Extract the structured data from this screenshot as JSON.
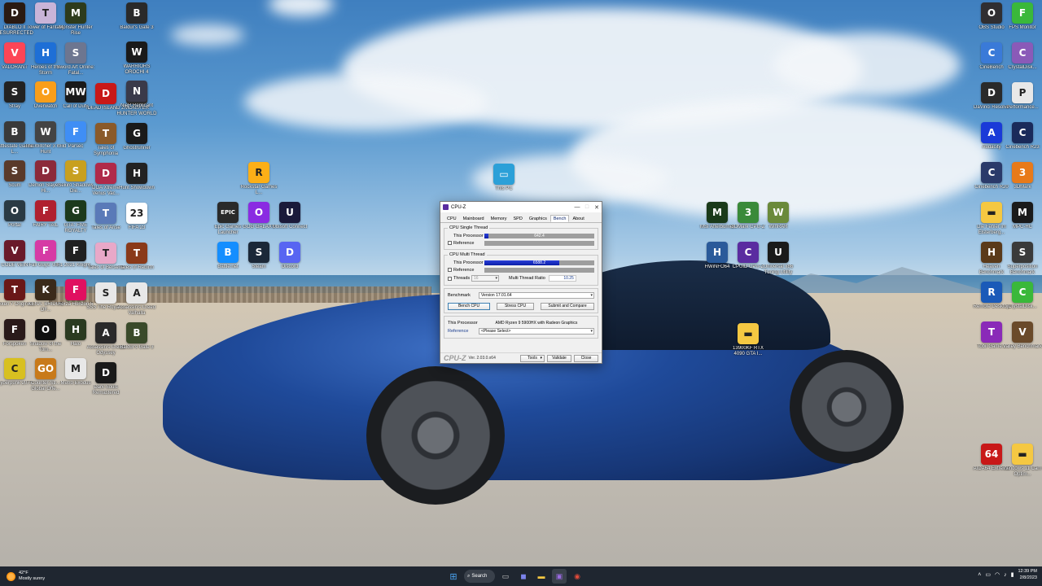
{
  "desktop": {
    "left_icons": [
      {
        "label": "DIABLO II RESURRECTED",
        "icon": "diablo-icon",
        "color": "#2a1a12",
        "glyph": "D"
      },
      {
        "label": "Tower of Fantasy",
        "icon": "tower-of-fantasy-icon",
        "color": "#c9b4d8",
        "glyph": "T"
      },
      {
        "label": "Monster Hunter Rise",
        "icon": "monster-hunter-icon",
        "color": "#2d3b1c",
        "glyph": "M"
      },
      {
        "label": "VALORANT",
        "icon": "valorant-icon",
        "color": "#fd4556",
        "glyph": "V"
      },
      {
        "label": "Heroes of the Storm",
        "icon": "heroes-storm-icon",
        "color": "#1e6fd6",
        "glyph": "H"
      },
      {
        "label": "Sword Art Online: Fatal...",
        "icon": "sword-art-icon",
        "color": "#6d7690",
        "glyph": "S"
      },
      {
        "label": "Stray",
        "icon": "stray-icon",
        "color": "#222222",
        "glyph": "S"
      },
      {
        "label": "Overwatch",
        "icon": "overwatch-icon",
        "color": "#f99e1a",
        "glyph": "O"
      },
      {
        "label": "Call of Duty",
        "icon": "call-of-duty-icon",
        "color": "#1a1a1a",
        "glyph": "MW"
      },
      {
        "label": "Battlestate Games L...",
        "icon": "battlestate-icon",
        "color": "#3a3a3a",
        "glyph": "B"
      },
      {
        "label": "The Witcher 3 Wild Hunt",
        "icon": "witcher-icon",
        "color": "#444444",
        "glyph": "W"
      },
      {
        "label": "Parsec",
        "icon": "parsec-icon",
        "color": "#3f8ef5",
        "glyph": "F"
      },
      {
        "label": "Scum",
        "icon": "scum-icon",
        "color": "#5a3a2a",
        "glyph": "S"
      },
      {
        "label": "Demon Slayer -Hi...",
        "icon": "demon-slayer-icon",
        "color": "#8c2a3a",
        "glyph": "D"
      },
      {
        "label": "Sekiro Shadows Die...",
        "icon": "sekiro-icon",
        "color": "#c8a020",
        "glyph": "S"
      },
      {
        "label": "Portal",
        "icon": "portal-icon",
        "color": "#2a3a44",
        "glyph": "O"
      },
      {
        "label": "FAIRY TAIL",
        "icon": "fairy-tail-icon",
        "color": "#b02030",
        "glyph": "F"
      },
      {
        "label": "GTA: FIVE ROYALTY",
        "icon": "gta-five-icon",
        "color": "#1c3a1c",
        "glyph": "G"
      },
      {
        "label": "CODE VEIN",
        "icon": "code-vein-icon",
        "color": "#6a1a2a",
        "glyph": "V"
      },
      {
        "label": "Fall Guys: Ult...",
        "icon": "fall-guys-icon",
        "color": "#d63aa5",
        "glyph": "F"
      },
      {
        "label": "F1 2021 Knight...",
        "icon": "f1-icon",
        "color": "#202020",
        "glyph": "F"
      },
      {
        "label": "Tekken 7 Original...",
        "icon": "tekken-icon",
        "color": "#6a1818",
        "glyph": "T"
      },
      {
        "label": "KENA: BRIDGE OF...",
        "icon": "kena-icon",
        "color": "#3a2a1a",
        "glyph": "K"
      },
      {
        "label": "Forza Horizon 5",
        "icon": "forza-icon",
        "color": "#e01060",
        "glyph": "F"
      },
      {
        "label": "Forspoken",
        "icon": "forspoken-icon",
        "color": "#2a1a1a",
        "glyph": "F"
      },
      {
        "label": "Shadow of the Tom...",
        "icon": "shadow-tomb-icon",
        "color": "#101010",
        "glyph": "O"
      },
      {
        "label": "Halo",
        "icon": "halo-icon",
        "color": "#2a3a20",
        "glyph": "H"
      },
      {
        "label": "Cyberpunk 2077",
        "icon": "cyberpunk-icon",
        "color": "#d8c020",
        "glyph": "C"
      },
      {
        "label": "Counter-Str... Global Offe...",
        "icon": "counter-strike-icon",
        "color": "#c87a1a",
        "glyph": "GO"
      },
      {
        "label": "Metro Exodus",
        "icon": "metro-icon",
        "color": "#e8e8e8",
        "glyph": "M"
      }
    ],
    "col3_icons": [
      {
        "label": "DEAD ISLAND 2",
        "icon": "dead-island-icon",
        "color": "#c81818",
        "glyph": "D"
      },
      {
        "label": "MONSTER HUNTER WORLD",
        "icon": "mhw-icon",
        "color": "#3a3a3a",
        "glyph": "M"
      },
      {
        "label": "Tales of Symphonia",
        "icon": "tales-symphonia-icon",
        "color": "#8a5a2a",
        "glyph": "T"
      },
      {
        "label": "Ghostrunner",
        "icon": "ghostrunner-icon",
        "color": "#1a1a1a",
        "glyph": "G"
      },
      {
        "label": "DOA Xtreme Venus Vac...",
        "icon": "doa-icon",
        "color": "#b02a4a",
        "glyph": "D"
      },
      {
        "label": "Hunt Showdown",
        "icon": "hunt-icon",
        "color": "#222222",
        "glyph": "H"
      },
      {
        "label": "Tales of Arise",
        "icon": "tales-arise-icon",
        "color": "#5a7ab8",
        "glyph": "T"
      },
      {
        "label": "FIFA 23",
        "icon": "fifa-icon",
        "color": "#ffffff",
        "glyph": "23"
      },
      {
        "label": "Tales of Berseria",
        "icon": "tales-berseria-icon",
        "color": "#e8a8c8",
        "glyph": "T"
      },
      {
        "label": "Tales of Rebirth",
        "icon": "tales-rebirth-icon",
        "color": "#8a3a1a",
        "glyph": "T"
      },
      {
        "label": "SSS The Royal ...",
        "icon": "sss-icon",
        "color": "#e8e8e8",
        "glyph": "S"
      },
      {
        "label": "Assassin's Creed Valhalla",
        "icon": "valhalla-icon",
        "color": "#e8e8e8",
        "glyph": "A"
      },
      {
        "label": "Assassin's Creed Odyssey",
        "icon": "odyssey-icon",
        "color": "#2a2a2a",
        "glyph": "A"
      },
      {
        "label": "Baldur's Gate 3",
        "icon": "baldurs-gate-icon",
        "color": "#3a4a2a",
        "glyph": "B"
      },
      {
        "label": "Dark Souls Remastered",
        "icon": "dark-souls-icon",
        "color": "#1a1a1a",
        "glyph": "D"
      }
    ],
    "col4_icons": [
      {
        "label": "Baldur's Gate 3",
        "icon": "baldurs-gate-3-icon",
        "color": "#2a2a2a",
        "glyph": "B"
      },
      {
        "label": "WARRIORS OROCHI 4",
        "icon": "warriors-orochi-icon",
        "color": "#1a1a1a",
        "glyph": "W"
      },
      {
        "label": "NieR Replicant",
        "icon": "nier-icon",
        "color": "#3a3a4a",
        "glyph": "N"
      },
      {
        "label": "Rockstar Games L...",
        "icon": "rockstar-icon",
        "color": "#fcaf17",
        "glyph": "R"
      },
      {
        "label": "Epic Games Launcher",
        "icon": "epic-games-icon",
        "color": "#2a2a2a",
        "glyph": "EPIC"
      },
      {
        "label": "GOG GALAXY",
        "icon": "gog-galaxy-icon",
        "color": "#8a2be2",
        "glyph": "O"
      },
      {
        "label": "Ubisoft Connect",
        "icon": "ubisoft-icon",
        "color": "#1a1a3a",
        "glyph": "U"
      },
      {
        "label": "Battle.net",
        "icon": "battle-net-icon",
        "color": "#148eff",
        "glyph": "B"
      },
      {
        "label": "Steam",
        "icon": "steam-icon",
        "color": "#1b2838",
        "glyph": "S"
      },
      {
        "label": "Discord",
        "icon": "discord-icon",
        "color": "#5865f2",
        "glyph": "D"
      }
    ],
    "mid_icons": [
      {
        "label": "This PC",
        "icon": "this-pc-icon",
        "color": "#2ba0d8",
        "glyph": "▭"
      },
      {
        "label": "MSI Afterburner",
        "icon": "msi-afterburner-icon",
        "color": "#1a3a1a",
        "glyph": "M"
      },
      {
        "label": "3DMark CPU-Z",
        "icon": "3dmark-icon",
        "color": "#3a8a3a",
        "glyph": "3"
      },
      {
        "label": "WinRAR",
        "icon": "winrar-icon",
        "color": "#6a8a3a",
        "glyph": "W"
      },
      {
        "label": "HWiNFO64",
        "icon": "hwinfo-icon",
        "color": "#2a5a9a",
        "glyph": "H"
      },
      {
        "label": "CPUID CPU-Z",
        "icon": "cpuid-icon",
        "color": "#5a2ca0",
        "glyph": "C"
      },
      {
        "label": "Universal x86 Tuning Utility",
        "icon": "tuning-utility-icon",
        "color": "#1a1a1a",
        "glyph": "U"
      },
      {
        "label": "13900KF RTX 4090 GTA I...",
        "icon": "folder-icon",
        "color": "#f5c842",
        "glyph": "▬"
      }
    ],
    "right_icons": [
      {
        "label": "OBS Studio",
        "icon": "obs-icon",
        "color": "#302e31",
        "glyph": "O"
      },
      {
        "label": "FPS Monitor",
        "icon": "fps-monitor-icon",
        "color": "#3ab83a",
        "glyph": "F"
      },
      {
        "label": "CineBench",
        "icon": "cinebench-icon",
        "color": "#3a7ad8",
        "glyph": "C"
      },
      {
        "label": "CrystalDisk...",
        "icon": "crystaldisk-icon",
        "color": "#8a5ab8",
        "glyph": "C"
      },
      {
        "label": "DaVinci Resolve",
        "icon": "davinci-icon",
        "color": "#2a2a2a",
        "glyph": "D"
      },
      {
        "label": "Performance...",
        "icon": "performance-icon",
        "color": "#e8e8e8",
        "glyph": "P"
      },
      {
        "label": "Audacity",
        "icon": "audacity-icon",
        "color": "#1a3ad8",
        "glyph": "A"
      },
      {
        "label": "Cinebench R23",
        "icon": "cinebench-r23-icon",
        "color": "#1a2a5a",
        "glyph": "C"
      },
      {
        "label": "Cinebench R20",
        "icon": "cinebench-r20-icon",
        "color": "#2a3a6a",
        "glyph": "C"
      },
      {
        "label": "3DMark",
        "icon": "3dmark-right-icon",
        "color": "#e87a1a",
        "glyph": "3"
      },
      {
        "label": "Die Fehler im Elsterberg...",
        "icon": "folder-2-icon",
        "color": "#f5c842",
        "glyph": "▬"
      },
      {
        "label": "MPC-HC",
        "icon": "mpc-hc-icon",
        "color": "#1a1a1a",
        "glyph": "M"
      },
      {
        "label": "Heaven Benchmark",
        "icon": "heaven-icon",
        "color": "#5a3a1a",
        "glyph": "H"
      },
      {
        "label": "Superposition Benchmark",
        "icon": "superposition-icon",
        "color": "#3a3a3a",
        "glyph": "S"
      },
      {
        "label": "Remote Desktop",
        "icon": "remote-desktop-icon",
        "color": "#1a5ab8",
        "glyph": "R"
      },
      {
        "label": "CrystalDisk...",
        "icon": "crystaldisk-2-icon",
        "color": "#3ab83a",
        "glyph": "C"
      },
      {
        "label": "Tobii Game...",
        "icon": "tobii-icon",
        "color": "#8a2ab8",
        "glyph": "T"
      },
      {
        "label": "Valley Benchmark",
        "icon": "valley-icon",
        "color": "#6a4a2a",
        "glyph": "V"
      },
      {
        "label": "AIDA64 Extreme",
        "icon": "aida64-icon",
        "color": "#c81818",
        "glyph": "64"
      },
      {
        "label": "Windows 11 Cam Optim...",
        "icon": "folder-3-icon",
        "color": "#f5c842",
        "glyph": "▬"
      }
    ]
  },
  "cpuz": {
    "title": "CPU-Z",
    "minimize": "—",
    "maximize": "□",
    "close": "✕",
    "tabs": [
      {
        "label": "CPU",
        "active": false
      },
      {
        "label": "Mainboard",
        "active": false
      },
      {
        "label": "Memory",
        "active": false
      },
      {
        "label": "SPD",
        "active": false
      },
      {
        "label": "Graphics",
        "active": false
      },
      {
        "label": "Bench",
        "active": true
      },
      {
        "label": "About",
        "active": false
      }
    ],
    "single": {
      "legend": "CPU Single Thread",
      "this_label": "This Processor",
      "this_value": "642.4",
      "this_fraction": 0.04,
      "ref_label": "Reference"
    },
    "multi": {
      "legend": "CPU Multi Thread",
      "this_label": "This Processor",
      "this_value": "6588.2",
      "this_fraction": 0.68,
      "ref_label": "Reference",
      "threads_label": "Threads",
      "threads_value": "16",
      "ratio_label": "Multi Thread Ratio",
      "ratio_value": "10.25"
    },
    "benchmark_label": "Benchmark",
    "benchmark_version": "Version 17.01.64",
    "bench_cpu": "Bench CPU",
    "stress_cpu": "Stress CPU",
    "submit_compare": "Submit and Compare",
    "this_processor_label": "This Processor",
    "processor_name": "AMD Ryzen 9 5900HX with Radeon Graphics",
    "reference_label": "Reference",
    "reference_value": "<Please Select>",
    "logo": "CPU-Z",
    "version": "Ver. 2.03.0.x64",
    "tools": "Tools",
    "validate": "Validate",
    "close_btn": "Close"
  },
  "taskbar": {
    "temperature": "42°F",
    "weather": "Mostly sunny",
    "search": "Search",
    "time": "12:39 PM",
    "date": "2/8/2023"
  }
}
